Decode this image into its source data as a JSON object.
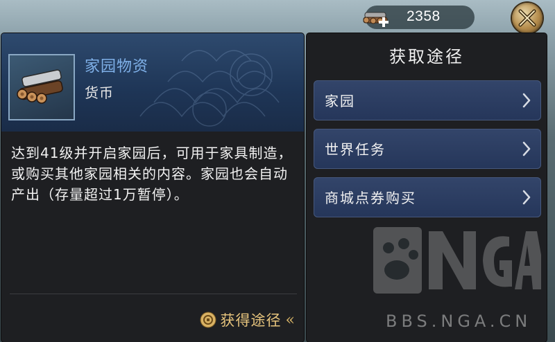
{
  "resource": {
    "amount": "2358",
    "icon": "lumber-plus-icon"
  },
  "item": {
    "name": "家园物资",
    "type": "货币",
    "description": "达到41级并开启家园后，可用于家具制造，或购买其他家园相关的内容。家园也会自动产出（存量超过1万暂停）。",
    "obtain_link": "获得途径",
    "obtain_arrows": "«",
    "icon": "lumber-bundle-icon"
  },
  "acquire": {
    "title": "获取途径",
    "options": [
      {
        "label": "家园"
      },
      {
        "label": "世界任务"
      },
      {
        "label": "商城点券购买"
      }
    ]
  },
  "watermark": {
    "logo_text": "NGA",
    "url": "BBS.NGA.CN"
  },
  "colors": {
    "accent_gold": "#e7c47d",
    "item_name_blue": "#7fb0e8",
    "button_blue": "#2c3e62"
  }
}
